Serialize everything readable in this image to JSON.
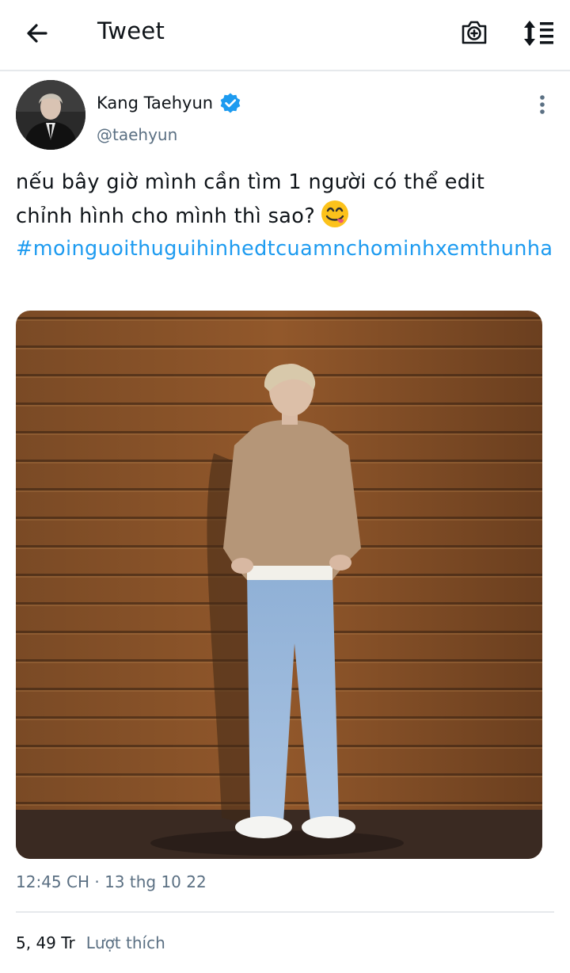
{
  "header": {
    "title": "Tweet",
    "back_icon": "arrow-left-icon",
    "camera_icon": "camera-plus-icon",
    "sort_icon": "sort-icon"
  },
  "tweet": {
    "author": {
      "name": "Kang Taehyun",
      "handle": "@taehyun",
      "verified": true,
      "verified_color": "#1d9bf0"
    },
    "text_lines": [
      "nếu bây giờ mình cần tìm 1 người có thể edit",
      "chỉnh hình cho mình thì sao?"
    ],
    "emoji": "face-savoring-food-emoji",
    "hashtag": "#moinguoithuguihinhedtcuamnchominhxemthunha",
    "timestamp": "12:45 CH · 13 thg 10 22",
    "likes_count": "5, 49 Tr",
    "likes_label": "Lượt thích"
  },
  "colors": {
    "link": "#1d9bf0",
    "secondary_text": "#5b7083",
    "primary_text": "#0f1419",
    "divider": "#e6e9ec"
  }
}
